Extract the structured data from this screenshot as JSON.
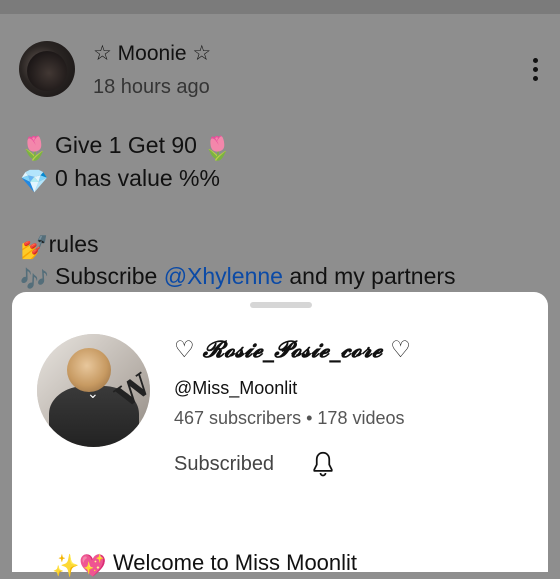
{
  "post": {
    "author": "☆ Moonie ☆",
    "timestamp": "18 hours ago",
    "lines": [
      {
        "icon": "tulip",
        "text": "Give 1 Get 90",
        "icon_after": "tulip"
      },
      {
        "icon": "gem",
        "text": "0 has value %%"
      },
      {
        "icon": "nail-polish",
        "text": "rules"
      },
      {
        "icon": "musical-notes",
        "text_before": "Subscribe",
        "mention": "@Xhylenne",
        "text_after": "and my partners"
      }
    ]
  },
  "channel_card": {
    "name": "♡ 𝓡𝓸𝓼𝓲𝓮_𝓟𝓸𝓼𝓲𝓮_𝓬𝓸𝓻𝓮 ♡",
    "handle": "@Miss_Moonlit",
    "subscribers": "467 subscribers",
    "videos": "178 videos",
    "separator": "•",
    "subscribe_state": "Subscribed",
    "welcome_partial": "Welcome to Miss Moonlit"
  },
  "colors": {
    "overlay_bg": "#8e8e8e",
    "mention": "#0b4aa6",
    "sheet_bg": "#ffffff"
  }
}
